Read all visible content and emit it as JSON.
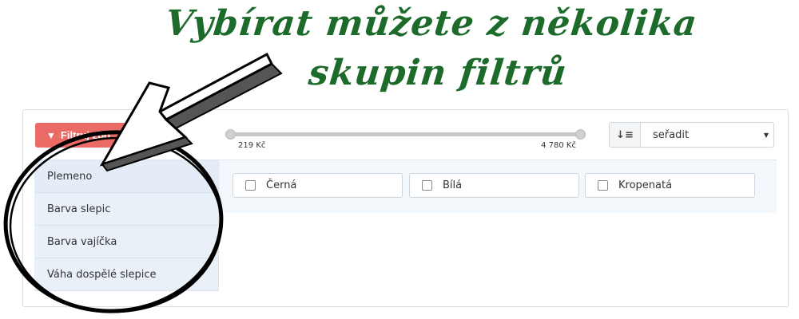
{
  "headline": {
    "line1": "Vybírat můžete z několika",
    "line2": "skupin filtrů"
  },
  "toolbar": {
    "filter_button_label": "Filtruj zbo",
    "filter_icon": "funnel-icon",
    "accent_color": "#ea6b66"
  },
  "price_slider": {
    "min_label": "219 Kč",
    "max_label": "4 780 Kč"
  },
  "sort": {
    "icon": "sort-icon",
    "value": "seřadit"
  },
  "filter_groups": [
    {
      "label": "Plemeno"
    },
    {
      "label": "Barva slepic"
    },
    {
      "label": "Barva vajíčka"
    },
    {
      "label": "Váha dospělé slepice"
    }
  ],
  "filter_options": [
    {
      "label": "Černá"
    },
    {
      "label": "Bílá"
    },
    {
      "label": "Kropenatá"
    }
  ]
}
